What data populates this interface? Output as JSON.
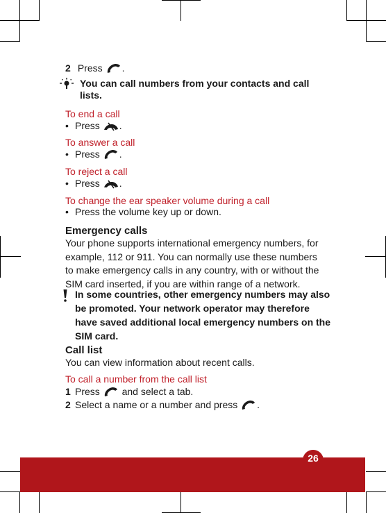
{
  "steps_top": [
    {
      "number": "2",
      "text_before": "Press",
      "icon": "call-icon",
      "text_after": "."
    }
  ],
  "tip": {
    "icon": "lightbulb-icon",
    "text_line1": "You can call numbers from your contacts and call",
    "text_line2": "lists."
  },
  "sections": [
    {
      "heading": "To end a call",
      "bullet": "•",
      "text": "Press",
      "icon": "end-call-icon",
      "after": "."
    },
    {
      "heading": "To answer a call",
      "bullet": "•",
      "text": "Press",
      "icon": "call-icon",
      "after": "."
    },
    {
      "heading": "To reject a call",
      "bullet": "•",
      "text": "Press",
      "icon": "end-call-icon",
      "after": "."
    },
    {
      "heading": "To change the ear speaker volume during a call",
      "bullet": "•",
      "text": "Press the volume key up or down."
    }
  ],
  "emergency": {
    "title": "Emergency calls",
    "lines": [
      "Your phone supports international emergency numbers, for",
      "example, 112 or 911. You can normally use these numbers",
      "to make emergency calls in any country, with or without the",
      "SIM card inserted, if you are within range of a network."
    ],
    "warning_icon": "exclamation-icon",
    "warning_lines": [
      "In some countries, other emergency numbers may also",
      "be promoted. Your network operator may therefore",
      "have saved additional local emergency numbers on the",
      "SIM card."
    ]
  },
  "call_list": {
    "title": "Call list",
    "description": "You can view information about recent calls.",
    "subheading": "To call a number from the call list",
    "steps": [
      {
        "number": "1",
        "before": "Press",
        "icon": "call-icon",
        "after": "and select a tab."
      },
      {
        "number": "2",
        "before": "Select a name or a number and press",
        "icon": "call-icon",
        "after": "."
      }
    ]
  },
  "footer": {
    "page_number": "26",
    "color": "#b0161b"
  },
  "colors": {
    "heading_red": "#c0202a",
    "text": "#1a1a1a"
  }
}
